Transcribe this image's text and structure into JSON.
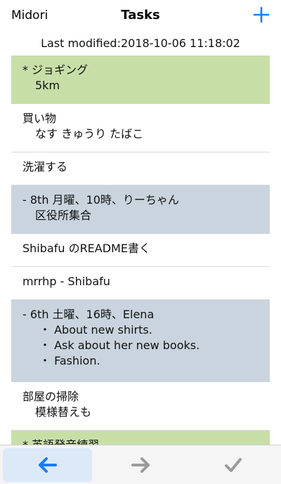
{
  "navbar": {
    "left_label": "Midori",
    "title": "Tasks",
    "add_icon": "plus-icon"
  },
  "last_modified": "Last modified:2018-10-06 11:18:02",
  "colors": {
    "accent": "#1a7cf5",
    "green_row": "#c7dfa7",
    "blue_row": "#c9d4de",
    "disabled_icon": "#9b9b9b"
  },
  "tasks": [
    {
      "style": "green",
      "lines": [
        "* ジョギング",
        "5km"
      ]
    },
    {
      "style": "plain",
      "lines": [
        "買い物",
        "なす きゅうり たばこ"
      ]
    },
    {
      "style": "plain",
      "lines": [
        "洗濯する"
      ]
    },
    {
      "style": "blue",
      "lines": [
        "- 8th 月曜、10時、りーちゃん",
        "区役所集合"
      ]
    },
    {
      "style": "plain",
      "lines": [
        "Shibafu のREADME書く"
      ]
    },
    {
      "style": "plain",
      "lines": [
        "mrrhp - Shibafu"
      ]
    },
    {
      "style": "blue",
      "lines": [
        "- 6th 土曜、16時、Elena",
        "・ About new shirts.",
        "・ Ask about her new books.",
        "・ Fashion."
      ]
    },
    {
      "style": "plain",
      "lines": [
        "部屋の掃除",
        "模様替えも"
      ]
    },
    {
      "style": "green",
      "lines": [
        "* 英語発音練習"
      ]
    }
  ],
  "toolbar": {
    "back_icon": "arrow-left-icon",
    "forward_icon": "arrow-right-icon",
    "done_icon": "checkmark-icon"
  }
}
